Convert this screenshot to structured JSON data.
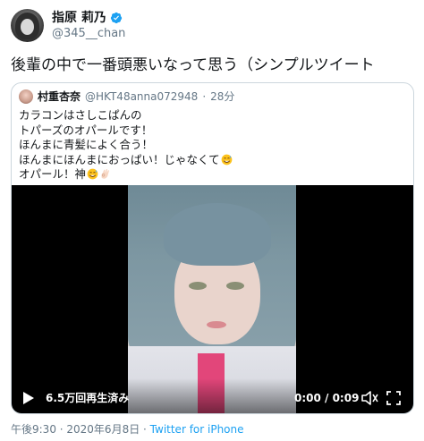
{
  "author": {
    "name": "指原 莉乃",
    "handle": "@345__chan",
    "verified": true
  },
  "tweet": {
    "text": "後輩の中で一番頭悪いなって思う（シンプルツイート"
  },
  "quoted": {
    "name": "村重杏奈",
    "handle": "@HKT48anna072948",
    "separator": "·",
    "time": "28分",
    "lines": [
      "カラコンはさしこぱんの",
      "トパーズのオパールです！",
      "ほんまに青髪によく合う！",
      "ほんまにほんまにおっぱい！じゃなくて",
      "オパール！神"
    ],
    "video": {
      "views": "6.5万回再生済み",
      "time": "0:00 / 0:09"
    }
  },
  "footer": {
    "datetime": "午後9:30 · 2020年6月8日 · ",
    "source": "Twitter for iPhone"
  },
  "colors": {
    "accent": "#1da1f2",
    "secondary_text": "#657786",
    "border": "#ccd6dd"
  },
  "icons": {
    "verified": "verified-badge-icon",
    "play": "play-icon",
    "volume": "volume-icon",
    "fullscreen": "fullscreen-icon",
    "emoji_sweat": "sweat-smile-emoji",
    "emoji_hand": "ok-hand-emoji"
  }
}
